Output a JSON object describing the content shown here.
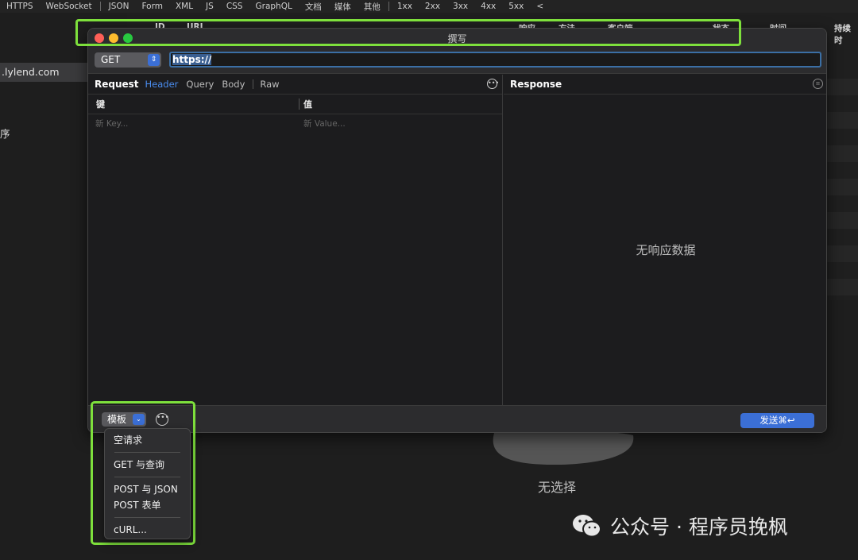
{
  "filter_bar": {
    "items": [
      "HTTPS",
      "WebSocket",
      "JSON",
      "Form",
      "XML",
      "JS",
      "CSS",
      "GraphQL",
      "文档",
      "媒体",
      "其他",
      "1xx",
      "2xx",
      "3xx",
      "4xx",
      "5xx",
      "<"
    ]
  },
  "sidebar": {
    "domain": ".lylend.com",
    "item": "序"
  },
  "table": {
    "columns": [
      "ID",
      "URL",
      "响应",
      "方法",
      "客户端",
      "状态",
      "时间",
      "持续时"
    ]
  },
  "empty_state": {
    "label": "无选择"
  },
  "watermark": {
    "text": "公众号 · 程序员挽枫"
  },
  "compose": {
    "title": "撰写",
    "method": "GET",
    "url": "https://",
    "request": {
      "title": "Request",
      "tabs": [
        "Header",
        "Query",
        "Body",
        "Raw"
      ],
      "active_tab": "Header",
      "key_header": "键",
      "value_header": "值",
      "key_placeholder": "新 Key...",
      "value_placeholder": "新 Value..."
    },
    "response": {
      "title": "Response",
      "empty": "无响应数据"
    },
    "send_label": "发送⌘↩",
    "template_label": "模板"
  },
  "template_menu": {
    "items": [
      "空请求",
      "GET 与查询",
      "POST 与 JSON",
      "POST 表单",
      "cURL..."
    ]
  },
  "colors": {
    "highlight": "#7ee03c",
    "accent": "#3b6fd6",
    "active_tab": "#4a8df0"
  }
}
